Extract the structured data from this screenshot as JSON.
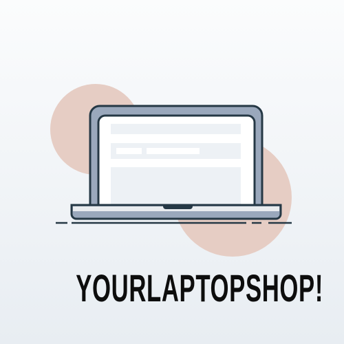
{
  "brand": {
    "name": "YOURLAPTOPSHOP!"
  },
  "colors": {
    "circle": "#e6cdc4",
    "outline": "#253845",
    "frame": "#9aa8bc",
    "screen": "#ffffff",
    "block": "#edf1f5",
    "base": "#e9ecef"
  },
  "icons": {
    "logo": "laptop-icon"
  }
}
